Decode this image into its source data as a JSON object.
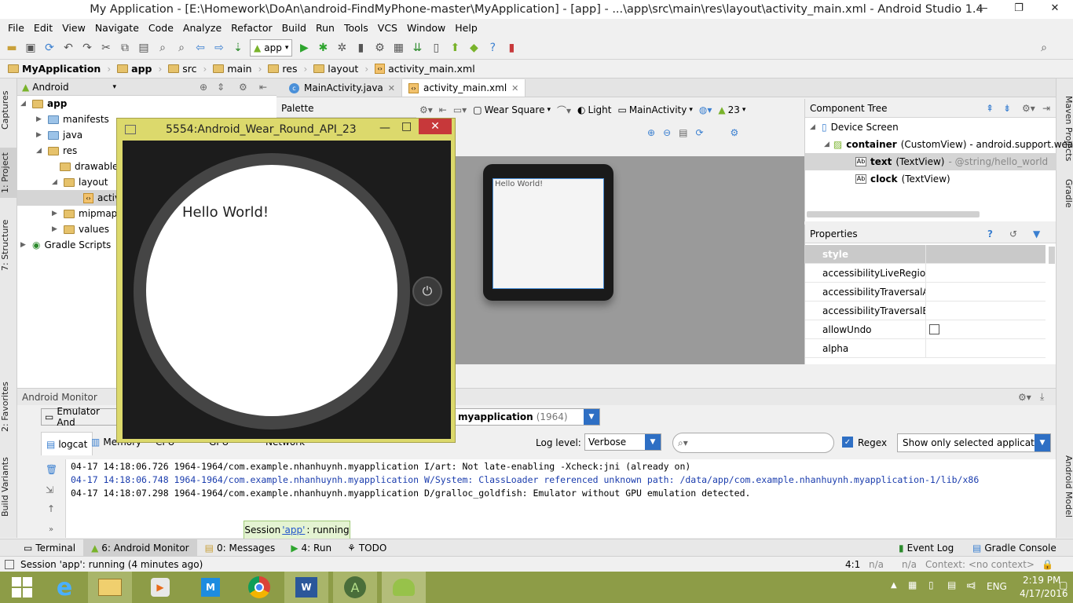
{
  "window": {
    "title": "My Application - [E:\\Homework\\DoAn\\android-FindMyPhone-master\\MyApplication] - [app] - ...\\app\\src\\main\\res\\layout\\activity_main.xml - Android Studio 1.4",
    "min": "—",
    "max": "❐",
    "close": "✕"
  },
  "menu": [
    "File",
    "Edit",
    "View",
    "Navigate",
    "Code",
    "Analyze",
    "Refactor",
    "Build",
    "Run",
    "Tools",
    "VCS",
    "Window",
    "Help"
  ],
  "toolbar": {
    "run_config": "app"
  },
  "breadcrumb": [
    "MyApplication",
    "app",
    "src",
    "main",
    "res",
    "layout",
    "activity_main.xml"
  ],
  "left_strip": {
    "captures": "Captures",
    "project": "1: Project",
    "structure": "7: Structure",
    "favorites": "2: Favorites",
    "build_variants": "Build Variants"
  },
  "right_strip": {
    "maven": "Maven Projects",
    "gradle": "Gradle",
    "android_model": "Android Model"
  },
  "project": {
    "view_selector": "Android",
    "tree": [
      {
        "label": "app",
        "bold": true
      },
      {
        "label": "manifests"
      },
      {
        "label": "java"
      },
      {
        "label": "res"
      },
      {
        "label": "drawable"
      },
      {
        "label": "layout"
      },
      {
        "label": "activi"
      },
      {
        "label": "mipmap"
      },
      {
        "label": "values"
      },
      {
        "label": "Gradle Scripts"
      }
    ]
  },
  "editor_tabs": [
    {
      "label": "MainActivity.java",
      "active": false
    },
    {
      "label": "activity_main.xml",
      "active": true
    }
  ],
  "palette": {
    "title": "Palette"
  },
  "design_toolbar": {
    "device": "Wear Square",
    "theme": "Light",
    "activity": "MainActivity",
    "api": "23"
  },
  "preview": {
    "text": "Hello World!"
  },
  "component_tree": {
    "title": "Component Tree",
    "root": "Device Screen",
    "container_id": "container",
    "container_type": "(CustomView) - android.support.weara",
    "text_id": "text",
    "text_type": "(TextView)",
    "text_ref": "- @string/hello_world",
    "clock_id": "clock",
    "clock_type": "(TextView)"
  },
  "properties": {
    "title": "Properties",
    "rows": [
      "style",
      "accessibilityLiveRegion",
      "accessibilityTraversalAfte",
      "accessibilityTraversalBefo",
      "allowUndo",
      "alpha"
    ]
  },
  "emulator": {
    "title": "5554:Android_Wear_Round_API_23",
    "screen_text": "Hello World!"
  },
  "monitor": {
    "title": "Android Monitor",
    "device_tab": "Emulator And",
    "process": "myapplication",
    "pid": "(1964)",
    "tabs": [
      "logcat",
      "Memory",
      "CPU",
      "GPU",
      "Network"
    ],
    "log_level_label": "Log level:",
    "log_level": "Verbose",
    "regex_label": "Regex",
    "filter": "Show only selected application",
    "logs": [
      "04-17 14:18:06.726 1964-1964/com.example.nhanhuynh.myapplication I/art: Not late-enabling -Xcheck:jni (already on)",
      "04-17 14:18:06.748 1964-1964/com.example.nhanhuynh.myapplication W/System: ClassLoader referenced unknown path: /data/app/com.example.nhanhuynh.myapplication-1/lib/x86",
      "04-17 14:18:07.298 1964-1964/com.example.nhanhuynh.myapplication D/gralloc_goldfish: Emulator without GPU emulation detected."
    ]
  },
  "session_tip": {
    "prefix": "Session",
    "app": "'app'",
    "suffix": ": running"
  },
  "bottom_tabs": [
    {
      "label": "Terminal"
    },
    {
      "label": "6: Android Monitor",
      "active": true
    },
    {
      "label": "0: Messages"
    },
    {
      "label": "4: Run"
    },
    {
      "label": "TODO"
    }
  ],
  "bottom_right": {
    "event_log": "Event Log",
    "gradle_console": "Gradle Console"
  },
  "status": {
    "message": "Session 'app': running (4 minutes ago)",
    "position": "4:1",
    "na1": "n/a",
    "na2": "n/a",
    "context": "Context: <no context>"
  },
  "taskbar": {
    "lang": "ENG",
    "time": "2:19 PM",
    "date": "4/17/2016"
  },
  "colors": {
    "accent": "#4a90d9",
    "emulator_frame": "#dcd96c",
    "taskbar": "#8d9c47",
    "close_red": "#c7383a"
  }
}
